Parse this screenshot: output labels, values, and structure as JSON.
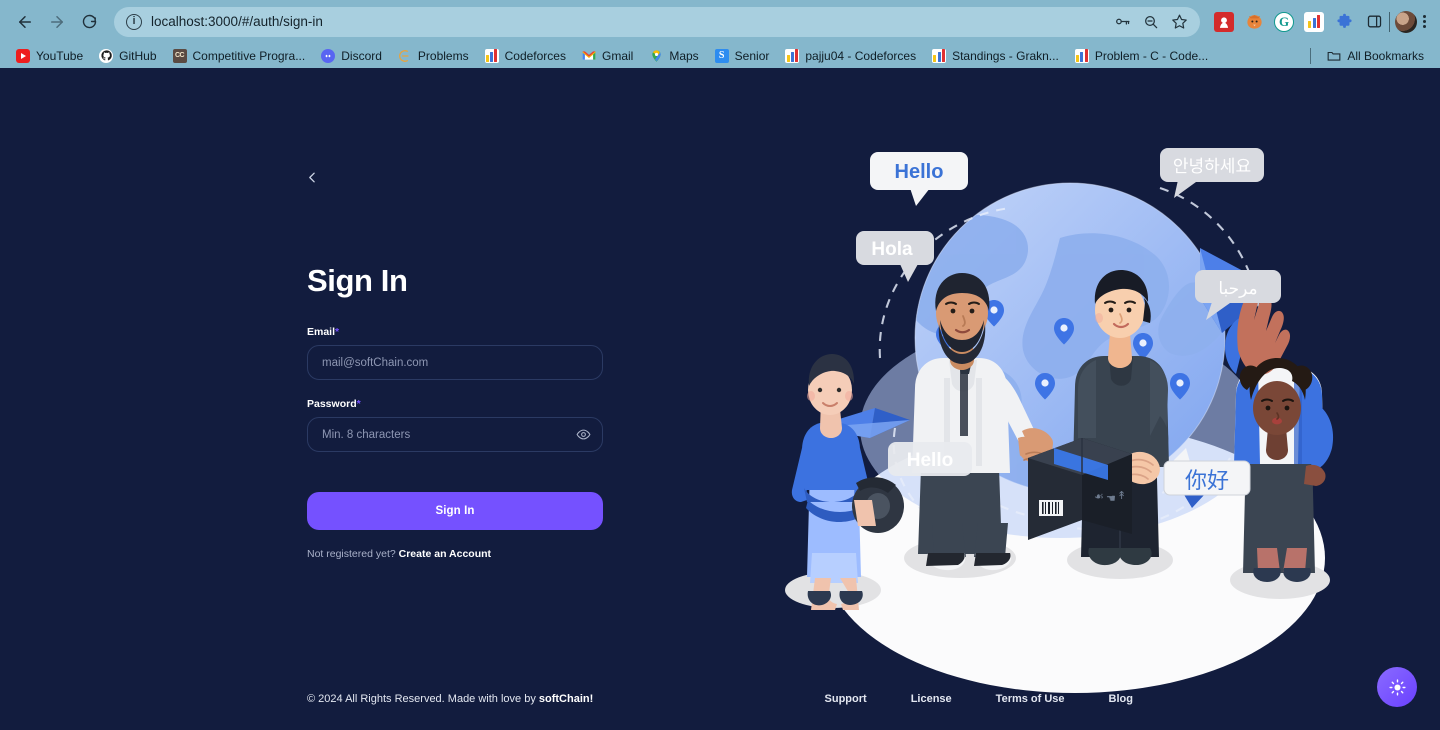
{
  "browser": {
    "nav": {
      "back": "back-arrow",
      "forward": "forward-arrow",
      "reload": "reload"
    },
    "omnibox": {
      "url": "localhost:3000/#/auth/sign-in",
      "info_icon": "ⓘ",
      "actions": [
        "password-key-icon",
        "zoom-out-icon",
        "bookmark-star-icon"
      ]
    },
    "extensions": [
      "anime-extension",
      "firefox-extension",
      "grammarly-extension",
      "codeforces-extension",
      "puzzle-extensions-icon",
      "side-panel-icon"
    ],
    "profile": "user-avatar",
    "menu": "chrome-menu",
    "bookmarks": [
      {
        "label": "YouTube",
        "icon": "youtube-icon"
      },
      {
        "label": "GitHub",
        "icon": "github-icon"
      },
      {
        "label": "Competitive Progra...",
        "icon": "cc-icon"
      },
      {
        "label": "Discord",
        "icon": "discord-icon"
      },
      {
        "label": "Problems",
        "icon": "problems-icon"
      },
      {
        "label": "Codeforces",
        "icon": "codeforces-icon"
      },
      {
        "label": "Gmail",
        "icon": "gmail-icon"
      },
      {
        "label": "Maps",
        "icon": "maps-icon"
      },
      {
        "label": "Senior",
        "icon": "senior-icon"
      },
      {
        "label": "pajju04 - Codeforces",
        "icon": "codeforces-icon"
      },
      {
        "label": "Standings - Grakn...",
        "icon": "codeforces-icon"
      },
      {
        "label": "Problem - C - Code...",
        "icon": "codeforces-icon"
      }
    ],
    "all_bookmarks": "All Bookmarks"
  },
  "page": {
    "back_label": "‹",
    "title": "Sign In",
    "email": {
      "label": "Email",
      "required_mark": "*",
      "placeholder": "mail@softChain.com",
      "value": ""
    },
    "password": {
      "label": "Password",
      "required_mark": "*",
      "placeholder": "Min. 8 characters",
      "value": "",
      "toggle": "show-password-eye"
    },
    "submit_label": "Sign In",
    "register_prompt": "Not registered yet?",
    "register_link": "Create an Account"
  },
  "illustration": {
    "alt": "people-communicating-globally",
    "bubbles": [
      {
        "text": "Hello",
        "lang": "en",
        "style": "accent"
      },
      {
        "text": "안녕하세요",
        "lang": "ko",
        "style": "muted"
      },
      {
        "text": "Hola",
        "lang": "es",
        "style": "muted"
      },
      {
        "text": "مرحبا",
        "lang": "ar",
        "style": "muted"
      },
      {
        "text": "Hello",
        "lang": "en",
        "style": "muted"
      },
      {
        "text": "你好",
        "lang": "zh",
        "style": "accent"
      }
    ]
  },
  "footer": {
    "copyright_prefix": "© 2024 All Rights Reserved. Made with love by ",
    "brand": "softChain!",
    "links": [
      {
        "label": "Support"
      },
      {
        "label": "License"
      },
      {
        "label": "Terms of Use"
      },
      {
        "label": "Blog"
      }
    ],
    "theme_toggle": "sun-icon"
  },
  "colors": {
    "page_bg": "#121c3e",
    "accent": "#7551ff",
    "chrome_bg": "#85b7cc",
    "omnibox_bg": "#a8cfdf",
    "input_border": "#2b3a63",
    "illus_blue": "#4d7fe8",
    "illus_light": "#a9c4f5"
  }
}
